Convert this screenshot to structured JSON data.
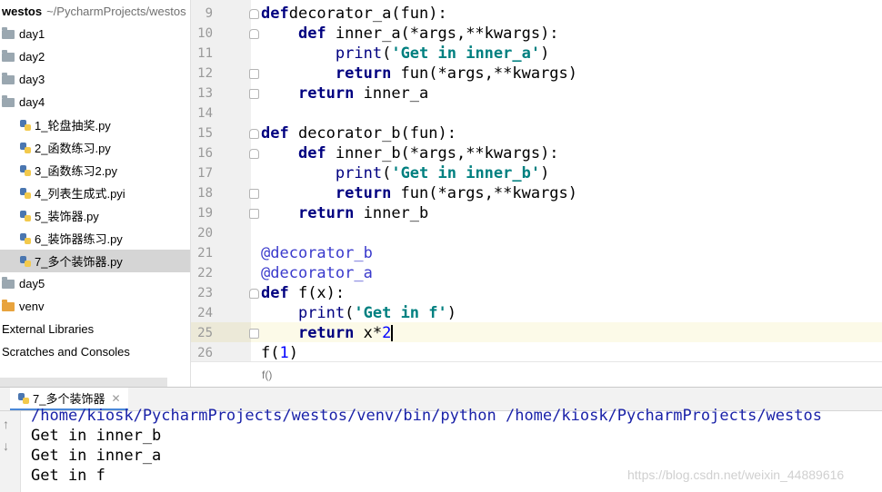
{
  "project": {
    "root_name": "westos",
    "root_path": "~/PycharmProjects/westos",
    "items": [
      {
        "type": "folder",
        "label": "day1",
        "indent": 0
      },
      {
        "type": "folder",
        "label": "day2",
        "indent": 0
      },
      {
        "type": "folder",
        "label": "day3",
        "indent": 0
      },
      {
        "type": "folder",
        "label": "day4",
        "indent": 0
      },
      {
        "type": "file",
        "label": "1_轮盘抽奖.py",
        "indent": 1
      },
      {
        "type": "file",
        "label": "2_函数练习.py",
        "indent": 1
      },
      {
        "type": "file",
        "label": "3_函数练习2.py",
        "indent": 1
      },
      {
        "type": "file",
        "label": "4_列表生成式.pyi",
        "indent": 1
      },
      {
        "type": "file",
        "label": "5_装饰器.py",
        "indent": 1
      },
      {
        "type": "file",
        "label": "6_装饰器练习.py",
        "indent": 1
      },
      {
        "type": "file",
        "label": "7_多个装饰器.py",
        "indent": 1,
        "selected": true
      },
      {
        "type": "folder",
        "label": "day5",
        "indent": 0
      },
      {
        "type": "folder-orange",
        "label": "venv",
        "indent": 0
      },
      {
        "type": "text",
        "label": "External Libraries",
        "indent": 0
      },
      {
        "type": "text",
        "label": "Scratches and Consoles",
        "indent": 0
      }
    ]
  },
  "editor": {
    "lines": [
      {
        "n": "9",
        "tokens": [
          [
            "kw",
            "def"
          ],
          [
            "",
            "decorator_a(fun):"
          ]
        ]
      },
      {
        "n": "10",
        "tokens": [
          [
            "",
            "    "
          ],
          [
            "kw",
            "def"
          ],
          [
            "",
            " inner_a(*args,**kwargs):"
          ]
        ]
      },
      {
        "n": "11",
        "tokens": [
          [
            "",
            "        "
          ],
          [
            "bi",
            "print"
          ],
          [
            "",
            "("
          ],
          [
            "str",
            "'Get in inner_a'"
          ],
          [
            "",
            ")"
          ]
        ]
      },
      {
        "n": "12",
        "tokens": [
          [
            "",
            "        "
          ],
          [
            "kw",
            "return"
          ],
          [
            "",
            " fun(*args,**kwargs)"
          ]
        ]
      },
      {
        "n": "13",
        "tokens": [
          [
            "",
            "    "
          ],
          [
            "kw",
            "return"
          ],
          [
            "",
            " inner_a"
          ]
        ]
      },
      {
        "n": "14",
        "tokens": []
      },
      {
        "n": "15",
        "tokens": [
          [
            "kw",
            "def"
          ],
          [
            "",
            " decorator_b(fun):"
          ]
        ]
      },
      {
        "n": "16",
        "tokens": [
          [
            "",
            "    "
          ],
          [
            "kw",
            "def"
          ],
          [
            "",
            " inner_b(*args,**kwargs):"
          ]
        ]
      },
      {
        "n": "17",
        "tokens": [
          [
            "",
            "        "
          ],
          [
            "bi",
            "print"
          ],
          [
            "",
            "("
          ],
          [
            "str",
            "'Get in inner_b'"
          ],
          [
            "",
            ")"
          ]
        ]
      },
      {
        "n": "18",
        "tokens": [
          [
            "",
            "        "
          ],
          [
            "kw",
            "return"
          ],
          [
            "",
            " fun(*args,**kwargs)"
          ]
        ]
      },
      {
        "n": "19",
        "tokens": [
          [
            "",
            "    "
          ],
          [
            "kw",
            "return"
          ],
          [
            "",
            " inner_b"
          ]
        ]
      },
      {
        "n": "20",
        "tokens": []
      },
      {
        "n": "21",
        "tokens": [
          [
            "deco",
            "@decorator_b"
          ]
        ]
      },
      {
        "n": "22",
        "tokens": [
          [
            "deco",
            "@decorator_a"
          ]
        ]
      },
      {
        "n": "23",
        "tokens": [
          [
            "kw",
            "def"
          ],
          [
            "",
            " f(x):"
          ]
        ]
      },
      {
        "n": "24",
        "tokens": [
          [
            "",
            "    "
          ],
          [
            "bi",
            "print"
          ],
          [
            "",
            "("
          ],
          [
            "str",
            "'Get in f'"
          ],
          [
            "",
            ")"
          ]
        ]
      },
      {
        "n": "25",
        "tokens": [
          [
            "",
            "    "
          ],
          [
            "kw",
            "return"
          ],
          [
            "",
            " x*"
          ],
          [
            "num",
            "2"
          ]
        ],
        "caret": true
      },
      {
        "n": "26",
        "tokens": [
          [
            "",
            "f("
          ],
          [
            "num",
            "1"
          ],
          [
            "",
            ")"
          ]
        ]
      }
    ],
    "breadcrumb": "f()"
  },
  "run": {
    "tab_label": "7_多个装饰器",
    "output": [
      "/home/kiosk/PycharmProjects/westos/venv/bin/python /home/kiosk/PycharmProjects/westos",
      "Get in inner_b",
      "Get in inner_a",
      "Get in f"
    ],
    "watermark": "https://blog.csdn.net/weixin_44889616"
  }
}
